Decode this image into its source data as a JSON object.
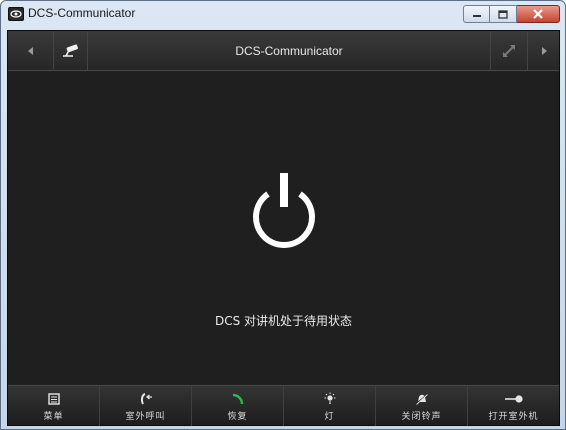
{
  "window": {
    "title": "DCS-Communicator",
    "controls": {
      "minimize": "minimize",
      "maximize": "maximize",
      "close": "close"
    }
  },
  "topbar": {
    "title": "DCS-Communicator",
    "icons": [
      "left-arrow-icon",
      "camera-icon",
      "expand-icon",
      "right-arrow-icon"
    ]
  },
  "main": {
    "status_text": "DCS 对讲机处于待用状态",
    "icon": "power-icon"
  },
  "bottombar": {
    "items": [
      {
        "label": "菜单",
        "icon": "menu-icon"
      },
      {
        "label": "室外呼叫",
        "icon": "outdoor-call-icon"
      },
      {
        "label": "恢复",
        "icon": "resume-call-icon"
      },
      {
        "label": "灯",
        "icon": "light-icon"
      },
      {
        "label": "关闭铃声",
        "icon": "mute-bell-icon"
      },
      {
        "label": "打开室外机",
        "icon": "key-icon"
      }
    ]
  },
  "colors": {
    "background": "#1f1f1f",
    "text": "#eaeaea",
    "resume_icon": "#2fb84a",
    "close_button": "#c7432f"
  }
}
